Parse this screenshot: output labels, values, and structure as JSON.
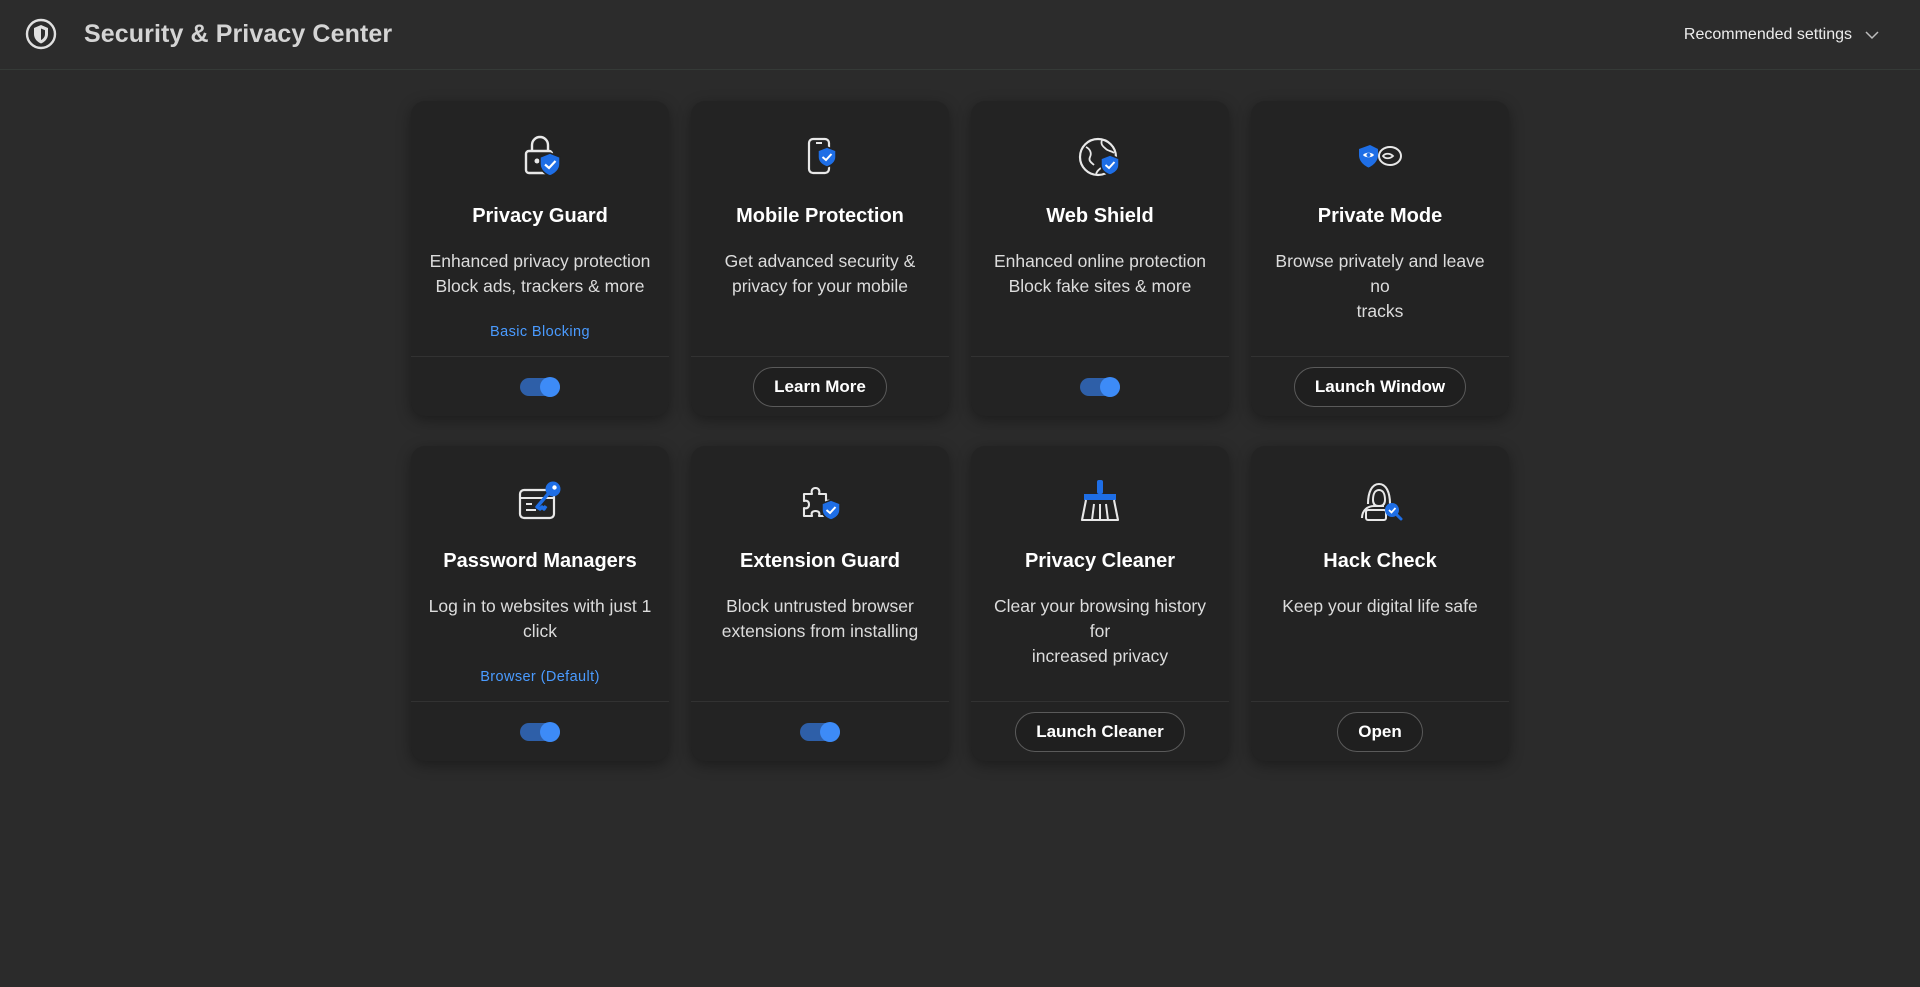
{
  "header": {
    "title": "Security & Privacy Center",
    "settings_label": "Recommended settings"
  },
  "colors": {
    "accent": "#3d8bf7",
    "background": "#2b2b2b",
    "card": "#232323"
  },
  "cards": [
    {
      "title": "Privacy Guard",
      "desc_line1": "Enhanced privacy protection",
      "desc_line2": "Block ads, trackers & more",
      "sub": "Basic Blocking",
      "control": "toggle",
      "icon": "lock-shield-icon"
    },
    {
      "title": "Mobile Protection",
      "desc_line1": "Get advanced security &",
      "desc_line2": "privacy for your mobile",
      "control": "button",
      "button_label": "Learn More",
      "icon": "mobile-shield-icon"
    },
    {
      "title": "Web Shield",
      "desc_line1": "Enhanced online protection",
      "desc_line2": "Block fake sites & more",
      "control": "toggle",
      "icon": "globe-shield-icon"
    },
    {
      "title": "Private Mode",
      "desc_line1": "Browse privately and leave no",
      "desc_line2": "tracks",
      "control": "button",
      "button_label": "Launch Window",
      "icon": "mask-icon"
    },
    {
      "title": "Password Managers",
      "desc_line1": "Log in to websites with just 1",
      "desc_line2": "click",
      "sub": "Browser (Default)",
      "control": "toggle",
      "icon": "key-window-icon"
    },
    {
      "title": "Extension Guard",
      "desc_line1": "Block untrusted browser",
      "desc_line2": "extensions from installing",
      "control": "toggle",
      "icon": "puzzle-shield-icon"
    },
    {
      "title": "Privacy Cleaner",
      "desc_line1": "Clear your browsing history for",
      "desc_line2": "increased privacy",
      "control": "button",
      "button_label": "Launch Cleaner",
      "icon": "broom-icon"
    },
    {
      "title": "Hack Check",
      "desc_line1": "Keep your digital life safe",
      "desc_line2": "",
      "control": "button",
      "button_label": "Open",
      "icon": "hacker-search-icon"
    }
  ]
}
